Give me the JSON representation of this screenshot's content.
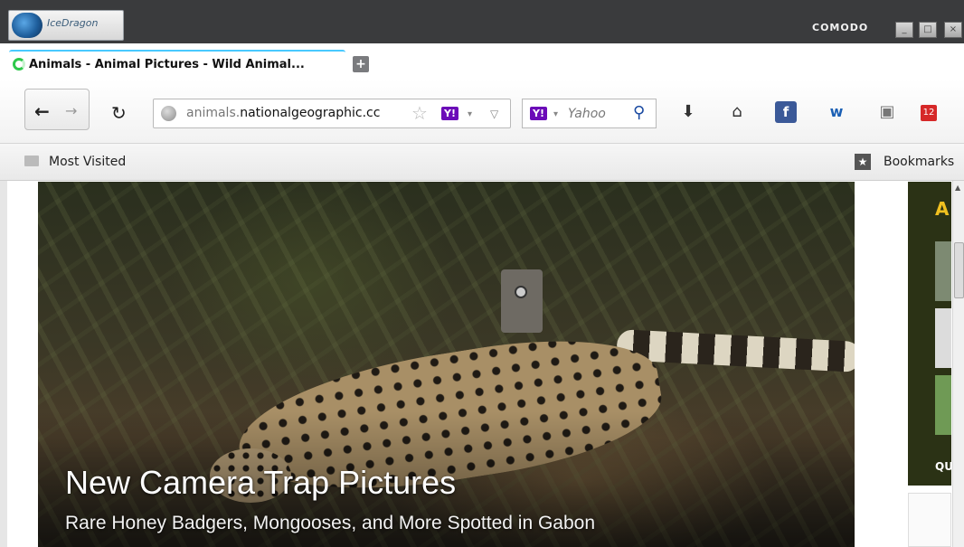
{
  "app": {
    "name": "IceDragon",
    "brand": "COMODO",
    "window_buttons": {
      "minimize": "_",
      "maximize": "□",
      "close": "×"
    }
  },
  "tab": {
    "title": "Animals - Animal Pictures - Wild Animal...",
    "new_tab": "+"
  },
  "navbar": {
    "back": "←",
    "forward": "→",
    "reload": "↻",
    "url_prefix": "animals.",
    "url_domain": "nationalgeographic.cc",
    "bookmark_star": "☆",
    "yahoo_badge": "Y!",
    "caret": "▾",
    "dropdown": "▽"
  },
  "search": {
    "engine_badge": "Y!",
    "placeholder": "Yahoo",
    "icon": "⚲"
  },
  "toolbar_icons": [
    "download-icon",
    "home-icon",
    "facebook-icon",
    "wordpress-icon",
    "screenshot-icon",
    "notifications-icon"
  ],
  "toolbar": {
    "download": "⬇",
    "home": "⌂",
    "facebook": "f",
    "w": "w",
    "screenshot": "▣",
    "notif_count": "12"
  },
  "bookmarks": {
    "most_visited": "Most Visited",
    "bookmarks_label": "Bookmarks"
  },
  "hero": {
    "title": "New Camera Trap Pictures",
    "subtitle": "Rare Honey Badgers, Mongooses, and More Spotted in Gabon"
  },
  "side_panel": {
    "header_letter": "A",
    "caption": "QU"
  },
  "colors": {
    "titlebar": "#3a3b3d",
    "tab_accent": "#49c9ff",
    "yahoo_purple": "#6b0ab8",
    "side_panel": "#2b3215",
    "side_accent": "#f0c020"
  }
}
